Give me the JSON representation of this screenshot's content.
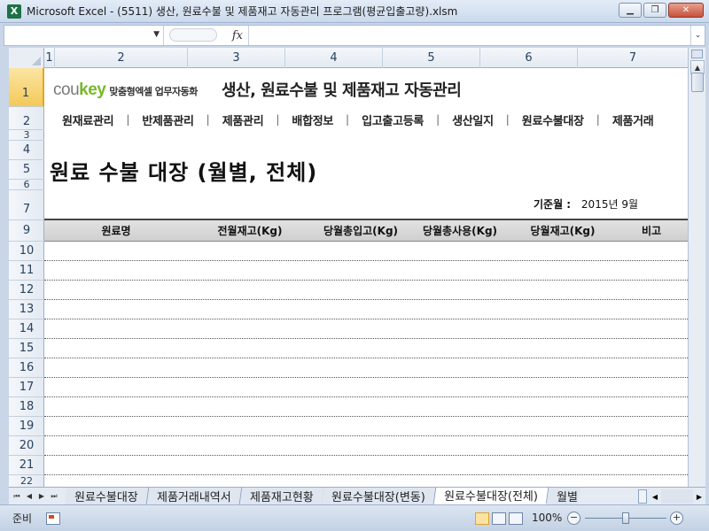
{
  "window": {
    "title": "Microsoft Excel - (5511) 생산, 원료수불 및 제품재고 자동관리 프로그램(평균입출고량).xlsm",
    "app_icon": "X"
  },
  "formula_bar": {
    "name_box": "",
    "fx_label": "fx",
    "formula": ""
  },
  "columns": [
    "1",
    "2",
    "3",
    "4",
    "5",
    "6",
    "7"
  ],
  "rows": [
    "1",
    "2",
    "3",
    "4",
    "5",
    "6",
    "7",
    "9",
    "10",
    "11",
    "12",
    "13",
    "14",
    "15",
    "16",
    "17",
    "18",
    "19",
    "20",
    "21",
    "22"
  ],
  "brand": {
    "logo_prefix": "cou",
    "logo_accent": "key",
    "tagline": "맞춤형엑셀 업무자동화",
    "app_title": "생산, 원료수불 및 제품재고 자동관리"
  },
  "nav": [
    "원재료관리",
    "반제품관리",
    "제품관리",
    "배합정보",
    "입고출고등록",
    "생산일지",
    "원료수불대장",
    "제품거래"
  ],
  "nav_separator": "|",
  "sheet": {
    "title": "원료 수불 대장 (월별, 전체)",
    "ref_label": "기준월 :",
    "ref_value": "2015년  9월"
  },
  "table": {
    "headers": [
      "원료명",
      "전월재고(Kg)",
      "당월총입고(Kg)",
      "당월총사용(Kg)",
      "당월재고(Kg)",
      "비고"
    ]
  },
  "tabs": [
    "원료수불대장",
    "제품거래내역서",
    "제품재고현황",
    "원료수불대장(변동)",
    "원료수불대장(전체)",
    "월별"
  ],
  "active_tab": "원료수불대장(전체)",
  "status": {
    "ready": "준비",
    "zoom": "100%"
  },
  "colors": {
    "brand_green": "#76b82a",
    "selected_row": "#f4c958",
    "table_header_bg": "#d6d6d6"
  }
}
